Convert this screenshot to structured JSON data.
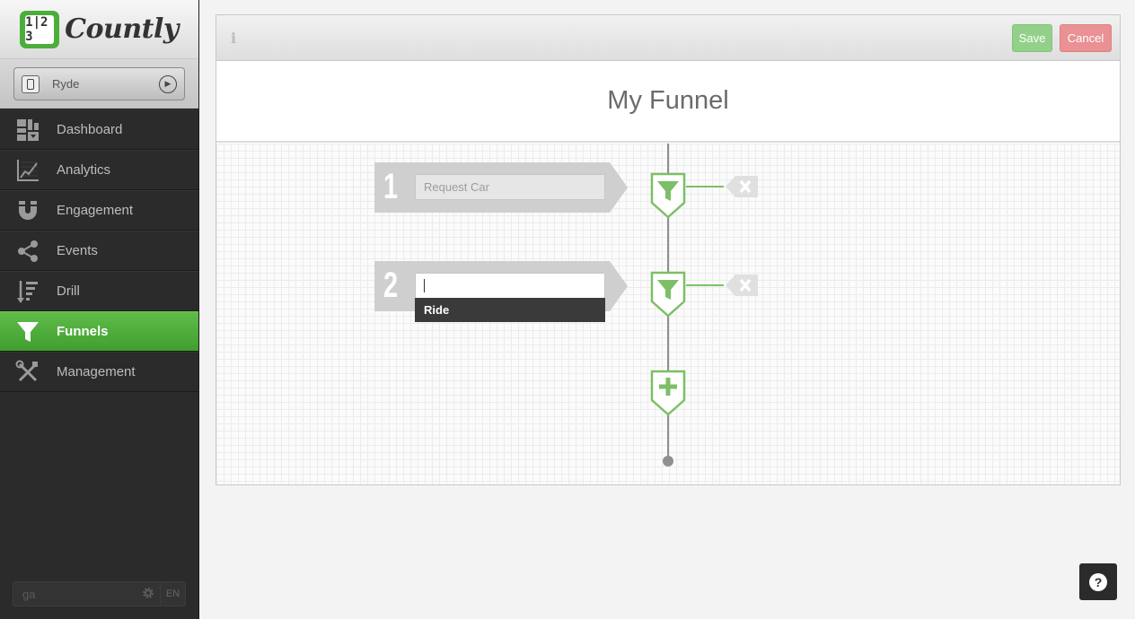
{
  "app": {
    "logo_text": "Countly",
    "logo_glyphs": "1|2 3",
    "selected_app": "Ryde"
  },
  "sidebar": {
    "items": [
      {
        "label": "Dashboard",
        "icon": "dashboard-icon",
        "active": false
      },
      {
        "label": "Analytics",
        "icon": "analytics-chart-icon",
        "active": false
      },
      {
        "label": "Engagement",
        "icon": "magnet-icon",
        "active": false
      },
      {
        "label": "Events",
        "icon": "share-nodes-icon",
        "active": false
      },
      {
        "label": "Drill",
        "icon": "sort-bars-icon",
        "active": false
      },
      {
        "label": "Funnels",
        "icon": "funnel-icon",
        "active": true
      },
      {
        "label": "Management",
        "icon": "wrench-screwdriver-icon",
        "active": false
      }
    ],
    "search_value": "ga",
    "language": "EN"
  },
  "toolbar": {
    "info_label": "i",
    "save_label": "Save",
    "cancel_label": "Cancel"
  },
  "funnel": {
    "title": "My Funnel",
    "steps": [
      {
        "number": "1",
        "event": "Request Car",
        "editing": false
      },
      {
        "number": "2",
        "event": "",
        "editing": true,
        "suggestions": [
          "Ride"
        ]
      }
    ],
    "add_step_icon": "plus-icon",
    "delete_icon": "close-x-icon"
  },
  "colors": {
    "accent_green": "#4cae3a",
    "save_green": "#93d18a",
    "cancel_red": "#ea9193",
    "sidebar_bg": "#2b2b2b"
  },
  "help": {
    "label": "?"
  }
}
